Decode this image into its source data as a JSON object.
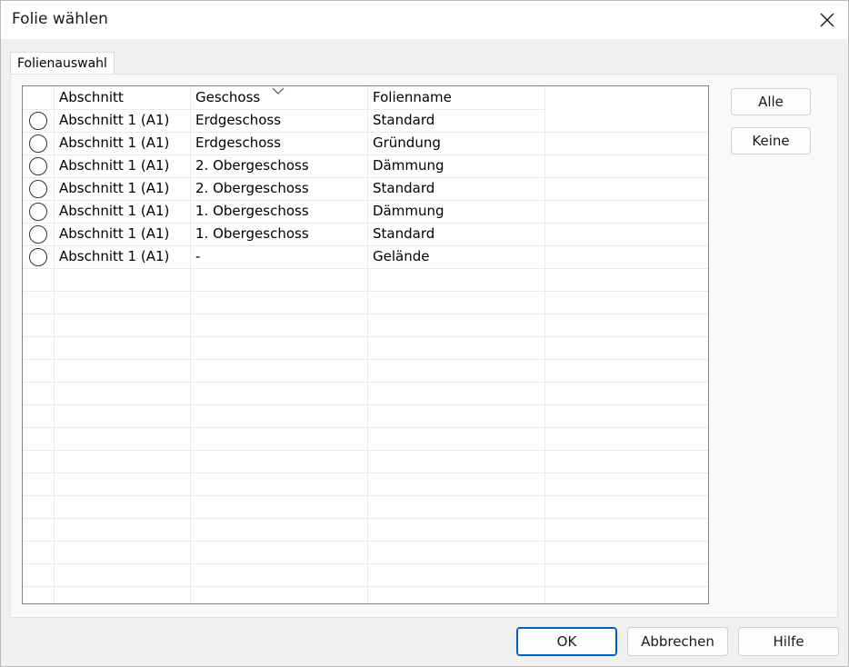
{
  "window": {
    "title": "Folie wählen"
  },
  "tabs": [
    {
      "label": "Folienauswahl"
    }
  ],
  "grid": {
    "columns": [
      "Abschnitt",
      "Geschoss",
      "Folienname"
    ],
    "sort_column": "Geschoss",
    "rows": [
      {
        "abschnitt": "Abschnitt 1 (A1)",
        "geschoss": "Erdgeschoss",
        "folienname": "Standard",
        "selected": false
      },
      {
        "abschnitt": "Abschnitt 1 (A1)",
        "geschoss": "Erdgeschoss",
        "folienname": "Gründung",
        "selected": false
      },
      {
        "abschnitt": "Abschnitt 1 (A1)",
        "geschoss": "2. Obergeschoss",
        "folienname": "Dämmung",
        "selected": false
      },
      {
        "abschnitt": "Abschnitt 1 (A1)",
        "geschoss": "2. Obergeschoss",
        "folienname": "Standard",
        "selected": false
      },
      {
        "abschnitt": "Abschnitt 1 (A1)",
        "geschoss": "1. Obergeschoss",
        "folienname": "Dämmung",
        "selected": false
      },
      {
        "abschnitt": "Abschnitt 1 (A1)",
        "geschoss": "1. Obergeschoss",
        "folienname": "Standard",
        "selected": false
      },
      {
        "abschnitt": "Abschnitt 1 (A1)",
        "geschoss": "-",
        "folienname": "Gelände",
        "selected": false
      }
    ]
  },
  "side_buttons": {
    "all": "Alle",
    "none": "Keine"
  },
  "footer": {
    "ok": "OK",
    "cancel": "Abbrechen",
    "help": "Hilfe"
  },
  "colors": {
    "accent": "#005fb8",
    "grid_line": "#eaeaea",
    "grid_border": "#828282"
  },
  "icons": {
    "close": "close-icon",
    "sort": "chevron-down-icon",
    "radio": "radio-button"
  }
}
